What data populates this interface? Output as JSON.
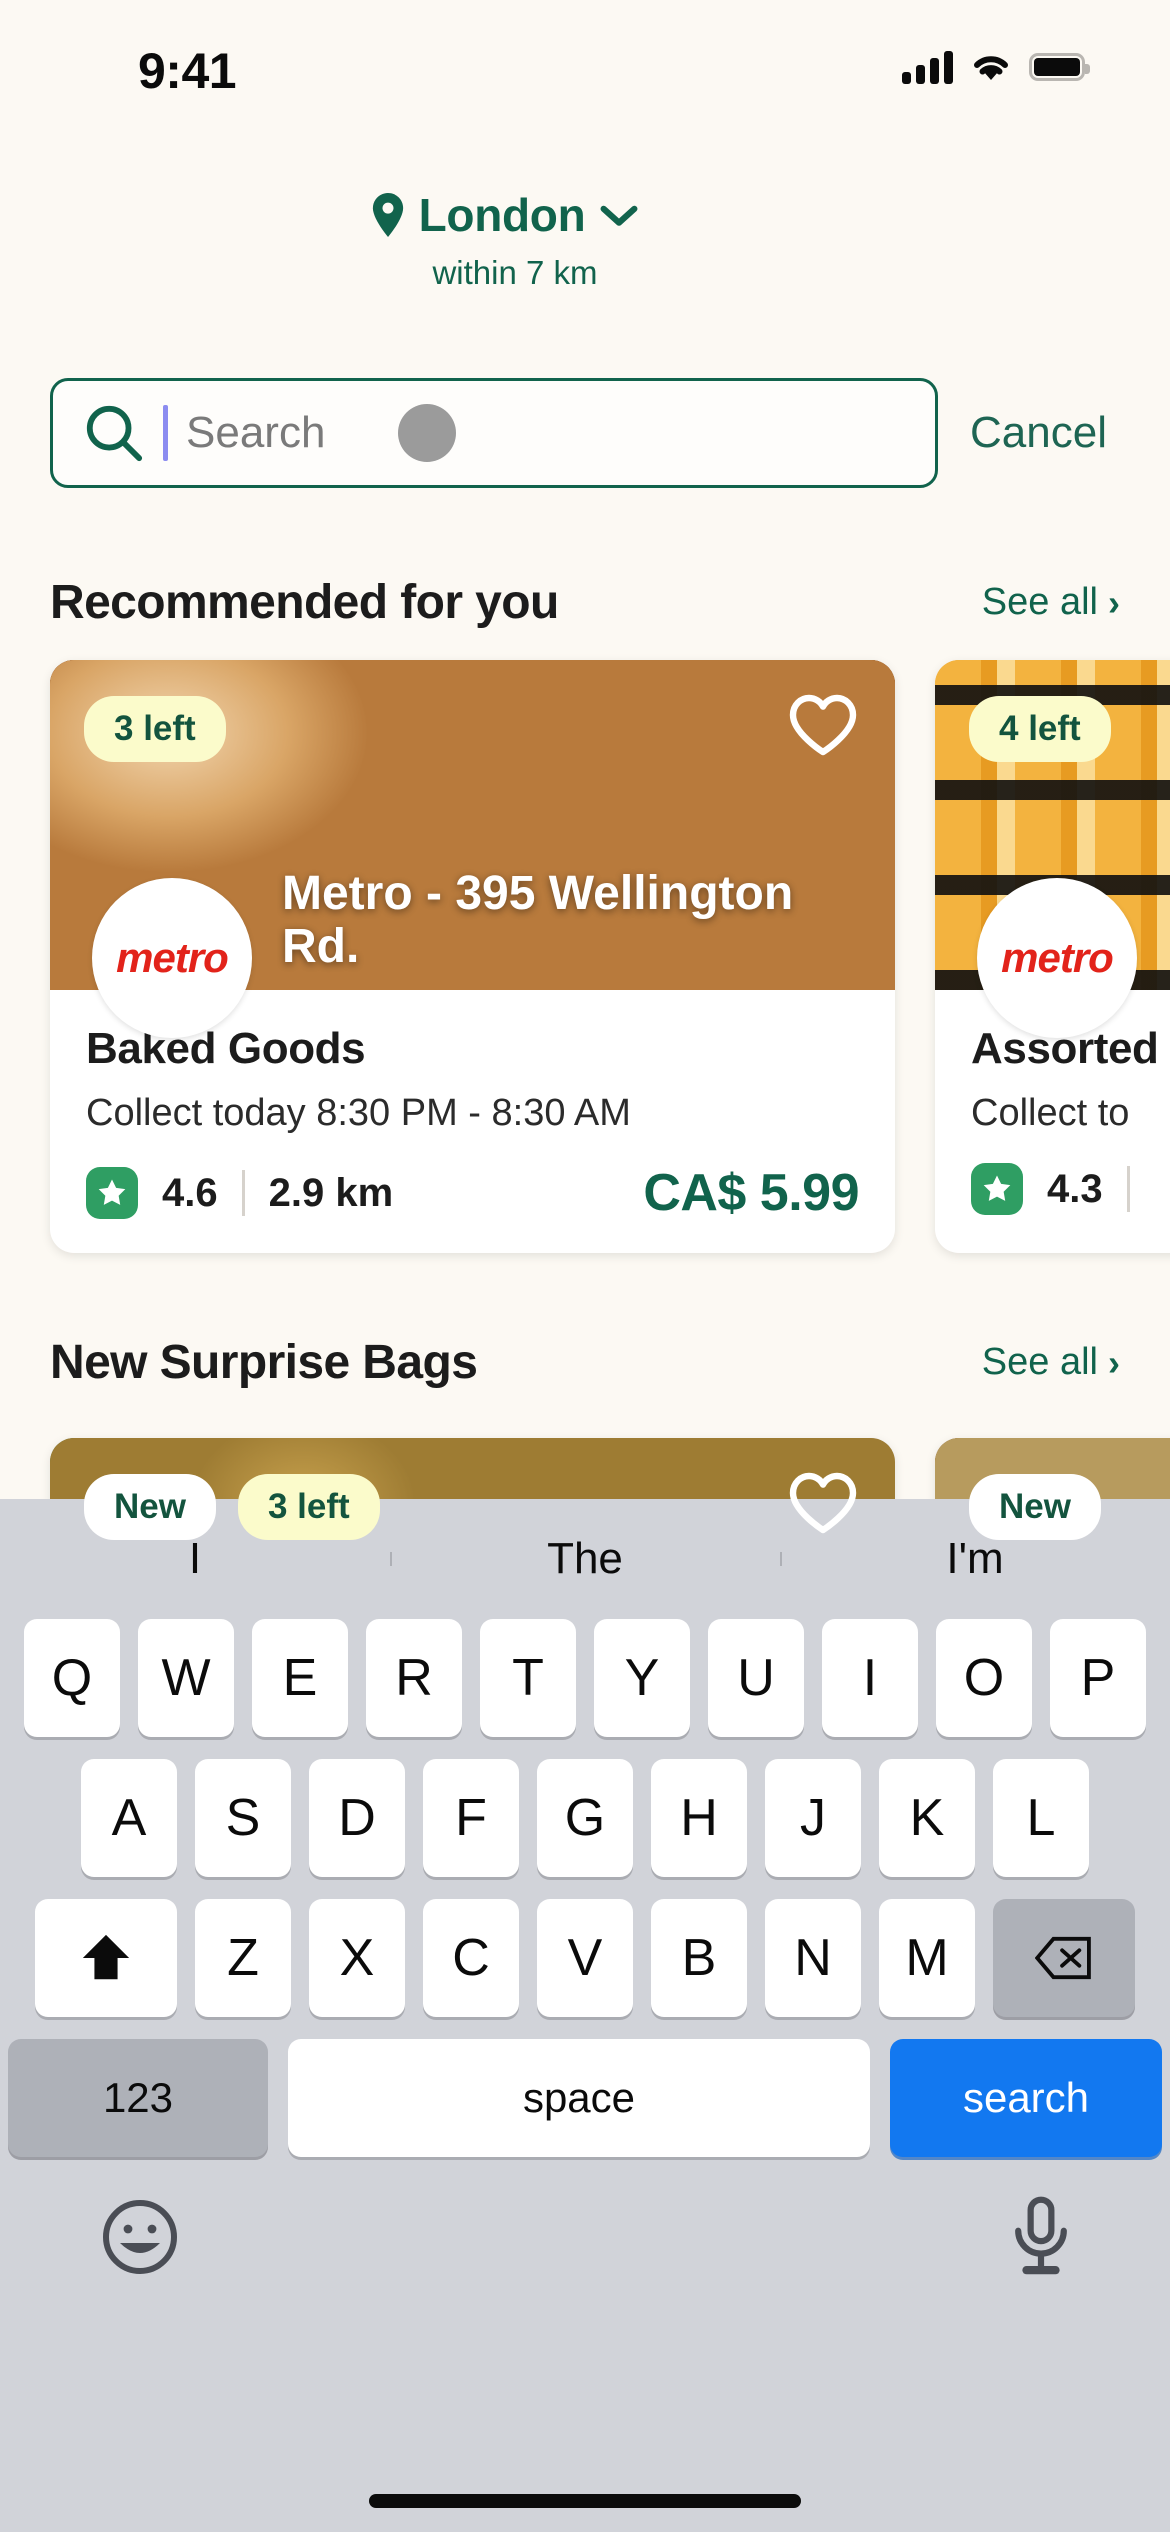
{
  "status_bar": {
    "time": "9:41",
    "signal_icon": "cellular-signal-icon",
    "wifi_icon": "wifi-icon",
    "battery_icon": "battery-full-icon"
  },
  "location": {
    "pin_icon": "location-pin-icon",
    "city": "London",
    "chevron_icon": "chevron-down-icon",
    "radius": "within 7 km"
  },
  "search": {
    "icon": "search-icon",
    "placeholder": "Search",
    "value": "",
    "cancel_label": "Cancel"
  },
  "theme": {
    "brand_green": "#11634C",
    "page_bg": "#FCF9F3",
    "badge_yellow": "#FBFBCB",
    "rating_green": "#2F9E63",
    "return_key_blue": "#1278F0",
    "metro_red": "#E2231A"
  },
  "sections": [
    {
      "title": "Recommended for you",
      "see_all_label": "See all",
      "cards": [
        {
          "badges": [
            "3 left"
          ],
          "store_logo_text": "metro",
          "store_name": "Metro - 395 Wellington Rd.",
          "favorite_icon": "heart-outline-icon",
          "title": "Baked Goods",
          "collect": "Collect today 8:30 PM - 8:30 AM",
          "rating": "4.6",
          "distance": "2.9 km",
          "price": "CA$ 5.99"
        },
        {
          "badges": [
            "4 left"
          ],
          "store_logo_text": "metro",
          "store_name": "",
          "favorite_icon": "heart-outline-icon",
          "title": "Assorted",
          "collect": "Collect to",
          "rating": "4.3",
          "distance": "",
          "price": ""
        }
      ]
    },
    {
      "title": "New Surprise Bags",
      "see_all_label": "See all",
      "cards": [
        {
          "badges": [
            "New",
            "3 left"
          ],
          "favorite_icon": "heart-outline-icon"
        },
        {
          "badges": [
            "New"
          ],
          "favorite_icon": "heart-outline-icon"
        }
      ]
    }
  ],
  "keyboard": {
    "suggestions": [
      "I",
      "The",
      "I'm"
    ],
    "row1": [
      "Q",
      "W",
      "E",
      "R",
      "T",
      "Y",
      "U",
      "I",
      "O",
      "P"
    ],
    "row2": [
      "A",
      "S",
      "D",
      "F",
      "G",
      "H",
      "J",
      "K",
      "L"
    ],
    "row3": [
      "Z",
      "X",
      "C",
      "V",
      "B",
      "N",
      "M"
    ],
    "shift_icon": "shift-arrow-up-icon",
    "backspace_icon": "backspace-delete-icon",
    "numbers_label": "123",
    "space_label": "space",
    "return_label": "search",
    "emoji_icon": "emoji-smiley-icon",
    "mic_icon": "microphone-icon"
  }
}
